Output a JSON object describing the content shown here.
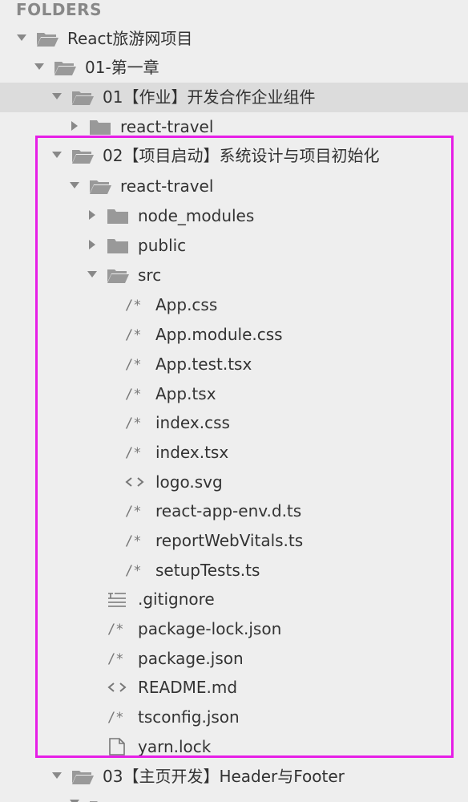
{
  "sidebar": {
    "header": "FOLDERS",
    "items": [
      {
        "label": "React旅游网项目",
        "kind": "folder",
        "state": "open"
      },
      {
        "label": "01-第一章",
        "kind": "folder",
        "state": "open"
      },
      {
        "label": "01【作业】开发合作企业组件",
        "kind": "folder",
        "state": "open"
      },
      {
        "label": "react-travel",
        "kind": "folder",
        "state": "closed"
      },
      {
        "label": "02【项目启动】系统设计与项目初始化",
        "kind": "folder",
        "state": "open"
      },
      {
        "label": "react-travel",
        "kind": "folder",
        "state": "open"
      },
      {
        "label": "node_modules",
        "kind": "folder",
        "state": "closed"
      },
      {
        "label": "public",
        "kind": "folder",
        "state": "closed"
      },
      {
        "label": "src",
        "kind": "folder",
        "state": "open"
      },
      {
        "label": "App.css",
        "kind": "file",
        "icon": "code-comment-icon"
      },
      {
        "label": "App.module.css",
        "kind": "file",
        "icon": "code-comment-icon"
      },
      {
        "label": "App.test.tsx",
        "kind": "file",
        "icon": "code-comment-icon"
      },
      {
        "label": "App.tsx",
        "kind": "file",
        "icon": "code-comment-icon"
      },
      {
        "label": "index.css",
        "kind": "file",
        "icon": "code-comment-icon"
      },
      {
        "label": "index.tsx",
        "kind": "file",
        "icon": "code-comment-icon"
      },
      {
        "label": "logo.svg",
        "kind": "file",
        "icon": "markup-brackets-icon"
      },
      {
        "label": "react-app-env.d.ts",
        "kind": "file",
        "icon": "code-comment-icon"
      },
      {
        "label": "reportWebVitals.ts",
        "kind": "file",
        "icon": "code-comment-icon"
      },
      {
        "label": "setupTests.ts",
        "kind": "file",
        "icon": "code-comment-icon"
      },
      {
        "label": ".gitignore",
        "kind": "file",
        "icon": "text-lines-icon"
      },
      {
        "label": "package-lock.json",
        "kind": "file",
        "icon": "code-comment-icon"
      },
      {
        "label": "package.json",
        "kind": "file",
        "icon": "code-comment-icon"
      },
      {
        "label": "README.md",
        "kind": "file",
        "icon": "markup-brackets-icon"
      },
      {
        "label": "tsconfig.json",
        "kind": "file",
        "icon": "code-comment-icon"
      },
      {
        "label": "yarn.lock",
        "kind": "file",
        "icon": "document-icon"
      },
      {
        "label": "03【主页开发】Header与Footer",
        "kind": "folder",
        "state": "open"
      }
    ]
  },
  "colors": {
    "highlight": "#e61ee6",
    "selected_row": "#dcdcdc",
    "background": "#eeeeee"
  }
}
